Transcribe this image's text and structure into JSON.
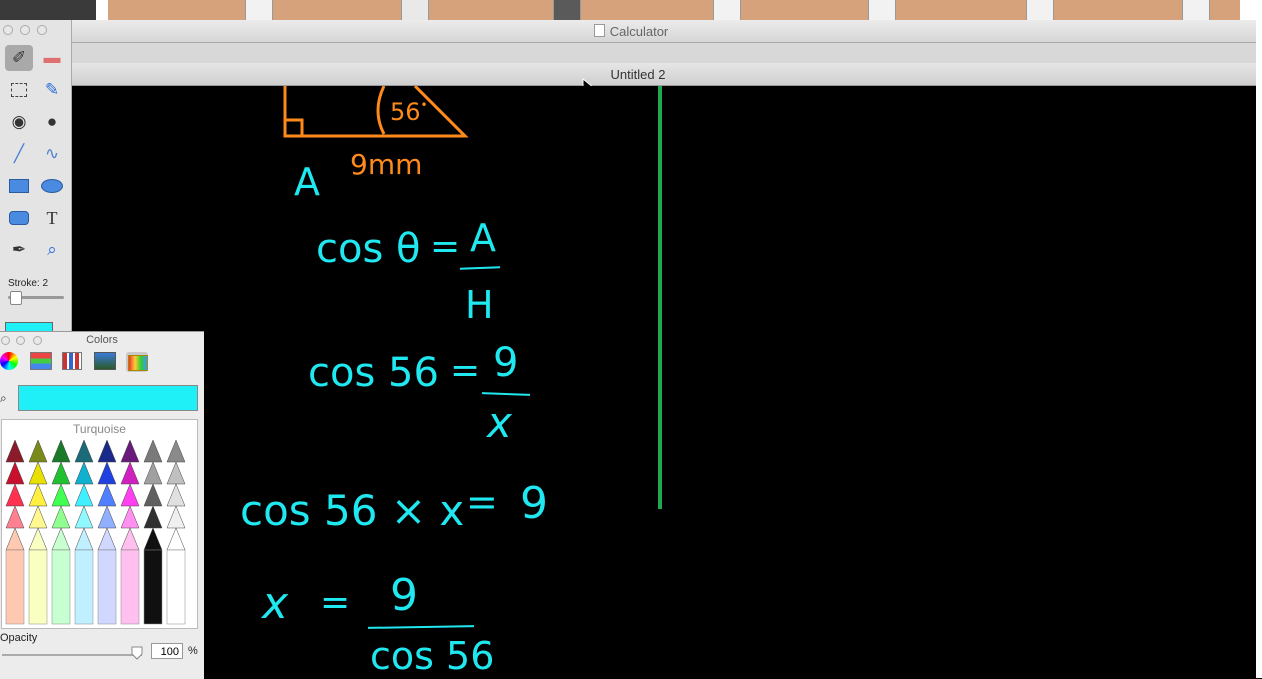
{
  "windows": {
    "calculator_title": "Calculator",
    "document_title": "Untitled 2"
  },
  "tools": {
    "stroke_label": "Stroke: 2",
    "text_tool_glyph": "T"
  },
  "colors_panel": {
    "title": "Colors",
    "color_name": "Turquoise",
    "selected_color": "#1ff0f8",
    "opacity_label": "Opacity",
    "opacity_value": "100",
    "opacity_unit": "%"
  },
  "drawing": {
    "ink_color": "#20e8f0",
    "triangle_color": "#ff8a1c",
    "divider_color": "#1fa84f",
    "angle_label": "56",
    "side_label": "9mm",
    "adjacent_label": "A",
    "line1_lhs": "cos θ",
    "line1_eq": "=",
    "line1_num": "A",
    "line1_den": "H",
    "line2_lhs": "cos 56",
    "line2_eq": "=",
    "line2_num": "9",
    "line2_den": "x",
    "line3_lhs": "cos 56 × x",
    "line3_eq": "=",
    "line3_rhs": "9",
    "line4_lhs": "x",
    "line4_eq": "=",
    "line4_num": "9",
    "line4_den": "cos 56"
  }
}
